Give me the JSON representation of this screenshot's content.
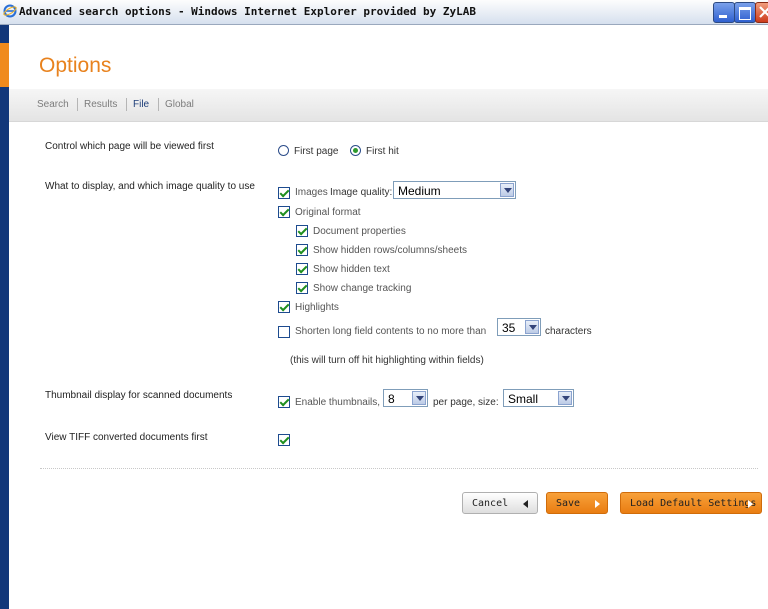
{
  "window": {
    "title": "Advanced search options - Windows Internet Explorer provided by ZyLAB"
  },
  "header": {
    "title": "Options"
  },
  "nav": {
    "tabs": [
      "Search",
      "Results",
      "File",
      "Global"
    ],
    "active": "File"
  },
  "form": {
    "first_page": {
      "label": "Control which page will be viewed first",
      "opt_first_page": "First page",
      "opt_first_hit": "First hit",
      "selected": "First hit"
    },
    "display": {
      "label": "What to display, and which image quality to use",
      "images_label": "Images",
      "image_quality_label": "Image quality:",
      "image_quality_value": "Medium",
      "original_format": "Original format",
      "doc_properties": "Document properties",
      "hidden_rows": "Show hidden rows/columns/sheets",
      "hidden_text": "Show hidden text",
      "change_tracking": "Show change tracking",
      "highlights": "Highlights",
      "shorten_prefix": "Shorten long field contents to no more than",
      "shorten_value": "35",
      "shorten_suffix": "characters",
      "shorten_note": "(this will turn off hit highlighting within fields)"
    },
    "thumbnails": {
      "label": "Thumbnail display for scanned documents",
      "enable_label": "Enable thumbnails,",
      "per_page_value": "8",
      "per_page_label": "per page, size:",
      "size_value": "Small"
    },
    "tiff": {
      "label": "View TIFF converted documents first"
    }
  },
  "buttons": {
    "cancel": "Cancel",
    "save": "Save",
    "load_default": "Load Default Settings"
  }
}
